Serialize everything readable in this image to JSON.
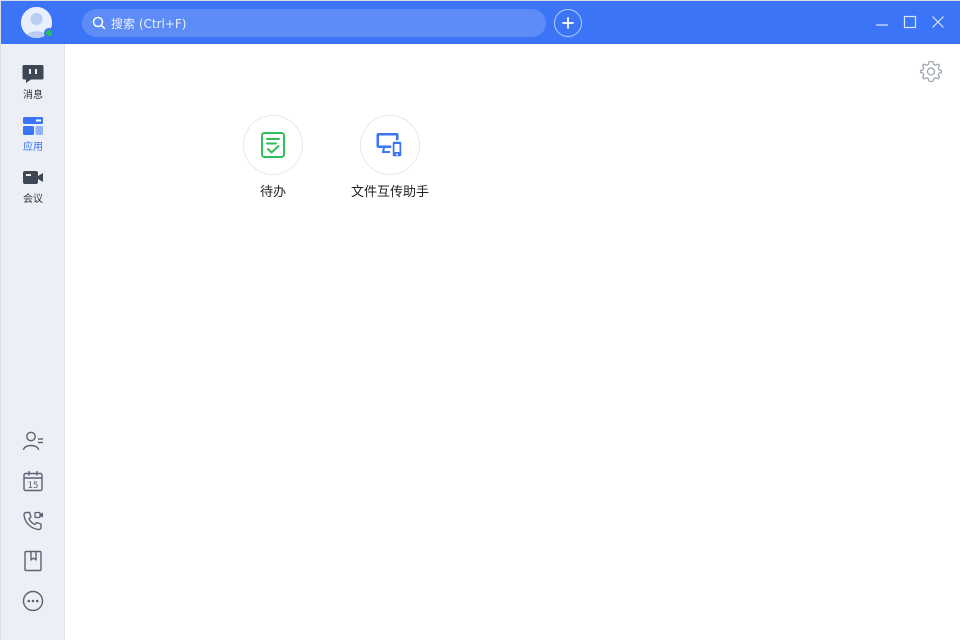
{
  "titlebar": {
    "search_placeholder": "搜索 (Ctrl+F)",
    "accent": "#3b74f6"
  },
  "sidebar": {
    "nav": [
      {
        "label": "消息",
        "icon": "message-icon",
        "active": false
      },
      {
        "label": "应用",
        "icon": "apps-icon",
        "active": true
      },
      {
        "label": "会议",
        "icon": "video-meeting-icon",
        "active": false
      }
    ],
    "tools": [
      {
        "icon": "contacts-icon"
      },
      {
        "icon": "calendar-icon",
        "text": "15"
      },
      {
        "icon": "phone-video-icon"
      },
      {
        "icon": "bookmark-icon"
      },
      {
        "icon": "more-icon"
      }
    ]
  },
  "main": {
    "apps": [
      {
        "label": "待办",
        "icon": "todo-icon",
        "color": "#2fbf5a"
      },
      {
        "label": "文件互传助手",
        "icon": "file-transfer-icon",
        "color": "#3b74f6"
      }
    ]
  }
}
